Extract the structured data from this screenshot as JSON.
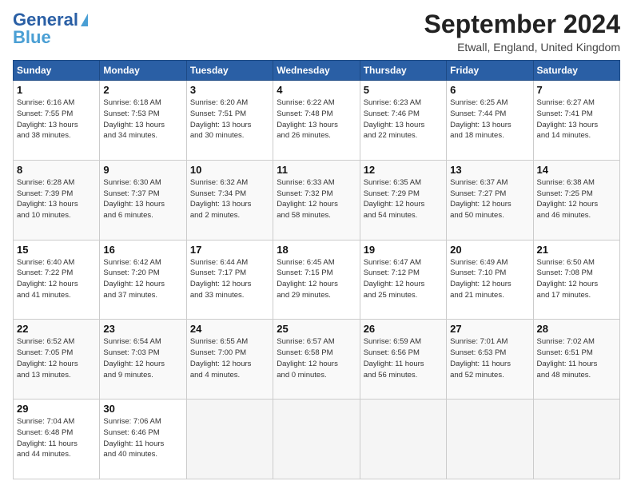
{
  "header": {
    "logo_line1": "General",
    "logo_line2": "Blue",
    "title": "September 2024",
    "subtitle": "Etwall, England, United Kingdom"
  },
  "days_of_week": [
    "Sunday",
    "Monday",
    "Tuesday",
    "Wednesday",
    "Thursday",
    "Friday",
    "Saturday"
  ],
  "weeks": [
    [
      {
        "day": "1",
        "info": "Sunrise: 6:16 AM\nSunset: 7:55 PM\nDaylight: 13 hours\nand 38 minutes."
      },
      {
        "day": "2",
        "info": "Sunrise: 6:18 AM\nSunset: 7:53 PM\nDaylight: 13 hours\nand 34 minutes."
      },
      {
        "day": "3",
        "info": "Sunrise: 6:20 AM\nSunset: 7:51 PM\nDaylight: 13 hours\nand 30 minutes."
      },
      {
        "day": "4",
        "info": "Sunrise: 6:22 AM\nSunset: 7:48 PM\nDaylight: 13 hours\nand 26 minutes."
      },
      {
        "day": "5",
        "info": "Sunrise: 6:23 AM\nSunset: 7:46 PM\nDaylight: 13 hours\nand 22 minutes."
      },
      {
        "day": "6",
        "info": "Sunrise: 6:25 AM\nSunset: 7:44 PM\nDaylight: 13 hours\nand 18 minutes."
      },
      {
        "day": "7",
        "info": "Sunrise: 6:27 AM\nSunset: 7:41 PM\nDaylight: 13 hours\nand 14 minutes."
      }
    ],
    [
      {
        "day": "8",
        "info": "Sunrise: 6:28 AM\nSunset: 7:39 PM\nDaylight: 13 hours\nand 10 minutes."
      },
      {
        "day": "9",
        "info": "Sunrise: 6:30 AM\nSunset: 7:37 PM\nDaylight: 13 hours\nand 6 minutes."
      },
      {
        "day": "10",
        "info": "Sunrise: 6:32 AM\nSunset: 7:34 PM\nDaylight: 13 hours\nand 2 minutes."
      },
      {
        "day": "11",
        "info": "Sunrise: 6:33 AM\nSunset: 7:32 PM\nDaylight: 12 hours\nand 58 minutes."
      },
      {
        "day": "12",
        "info": "Sunrise: 6:35 AM\nSunset: 7:29 PM\nDaylight: 12 hours\nand 54 minutes."
      },
      {
        "day": "13",
        "info": "Sunrise: 6:37 AM\nSunset: 7:27 PM\nDaylight: 12 hours\nand 50 minutes."
      },
      {
        "day": "14",
        "info": "Sunrise: 6:38 AM\nSunset: 7:25 PM\nDaylight: 12 hours\nand 46 minutes."
      }
    ],
    [
      {
        "day": "15",
        "info": "Sunrise: 6:40 AM\nSunset: 7:22 PM\nDaylight: 12 hours\nand 41 minutes."
      },
      {
        "day": "16",
        "info": "Sunrise: 6:42 AM\nSunset: 7:20 PM\nDaylight: 12 hours\nand 37 minutes."
      },
      {
        "day": "17",
        "info": "Sunrise: 6:44 AM\nSunset: 7:17 PM\nDaylight: 12 hours\nand 33 minutes."
      },
      {
        "day": "18",
        "info": "Sunrise: 6:45 AM\nSunset: 7:15 PM\nDaylight: 12 hours\nand 29 minutes."
      },
      {
        "day": "19",
        "info": "Sunrise: 6:47 AM\nSunset: 7:12 PM\nDaylight: 12 hours\nand 25 minutes."
      },
      {
        "day": "20",
        "info": "Sunrise: 6:49 AM\nSunset: 7:10 PM\nDaylight: 12 hours\nand 21 minutes."
      },
      {
        "day": "21",
        "info": "Sunrise: 6:50 AM\nSunset: 7:08 PM\nDaylight: 12 hours\nand 17 minutes."
      }
    ],
    [
      {
        "day": "22",
        "info": "Sunrise: 6:52 AM\nSunset: 7:05 PM\nDaylight: 12 hours\nand 13 minutes."
      },
      {
        "day": "23",
        "info": "Sunrise: 6:54 AM\nSunset: 7:03 PM\nDaylight: 12 hours\nand 9 minutes."
      },
      {
        "day": "24",
        "info": "Sunrise: 6:55 AM\nSunset: 7:00 PM\nDaylight: 12 hours\nand 4 minutes."
      },
      {
        "day": "25",
        "info": "Sunrise: 6:57 AM\nSunset: 6:58 PM\nDaylight: 12 hours\nand 0 minutes."
      },
      {
        "day": "26",
        "info": "Sunrise: 6:59 AM\nSunset: 6:56 PM\nDaylight: 11 hours\nand 56 minutes."
      },
      {
        "day": "27",
        "info": "Sunrise: 7:01 AM\nSunset: 6:53 PM\nDaylight: 11 hours\nand 52 minutes."
      },
      {
        "day": "28",
        "info": "Sunrise: 7:02 AM\nSunset: 6:51 PM\nDaylight: 11 hours\nand 48 minutes."
      }
    ],
    [
      {
        "day": "29",
        "info": "Sunrise: 7:04 AM\nSunset: 6:48 PM\nDaylight: 11 hours\nand 44 minutes."
      },
      {
        "day": "30",
        "info": "Sunrise: 7:06 AM\nSunset: 6:46 PM\nDaylight: 11 hours\nand 40 minutes."
      },
      {
        "day": "",
        "info": ""
      },
      {
        "day": "",
        "info": ""
      },
      {
        "day": "",
        "info": ""
      },
      {
        "day": "",
        "info": ""
      },
      {
        "day": "",
        "info": ""
      }
    ]
  ]
}
